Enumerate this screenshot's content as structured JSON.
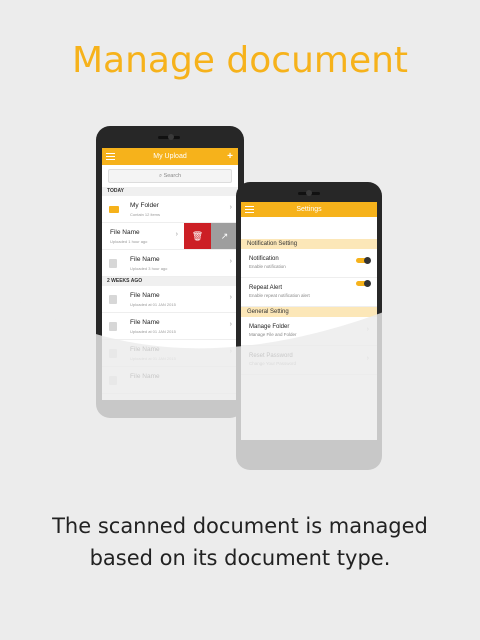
{
  "headline": "Manage document",
  "caption": "The scanned document is managed based on its document type.",
  "colors": {
    "accent": "#f6b21b",
    "delete": "#cc1f25"
  },
  "phone1": {
    "title": "My Upload",
    "search_placeholder": "Search",
    "sections": [
      {
        "label": "TODAY"
      },
      {
        "label": "2 WEEKS AGO"
      }
    ],
    "today_items": [
      {
        "title": "My Folder",
        "subtitle": "Contain 12 items",
        "icon": "folder-icon"
      },
      {
        "title": "File Name",
        "subtitle": "Uploaded 1 hour ago",
        "icon": "file-icon"
      },
      {
        "title": "File Name",
        "subtitle": "Uploaded 3 hour ago",
        "icon": "file-icon"
      }
    ],
    "older_items": [
      {
        "title": "File Name",
        "subtitle": "Uploaded at 01 JAN 2015"
      },
      {
        "title": "File Name",
        "subtitle": "Uploaded at 01 JAN 2015"
      },
      {
        "title": "File Name",
        "subtitle": "Uploaded at 01 JAN 2015"
      },
      {
        "title": "File Name",
        "subtitle": ""
      }
    ],
    "swipe_actions": {
      "delete_icon": "trash-icon",
      "share_icon": "share-icon"
    }
  },
  "phone2": {
    "title": "Settings",
    "sections": [
      {
        "label": "Notification Setting"
      },
      {
        "label": "General Setting"
      }
    ],
    "notification_items": [
      {
        "title": "Notification",
        "subtitle": "Enable notification",
        "toggle": true
      },
      {
        "title": "Repeat Alert",
        "subtitle": "Enable repeat notification alert",
        "toggle": true
      }
    ],
    "general_items": [
      {
        "title": "Manage Folder",
        "subtitle": "Manage File and Folder"
      },
      {
        "title": "Reset Password",
        "subtitle": "Change Your Password"
      }
    ]
  }
}
